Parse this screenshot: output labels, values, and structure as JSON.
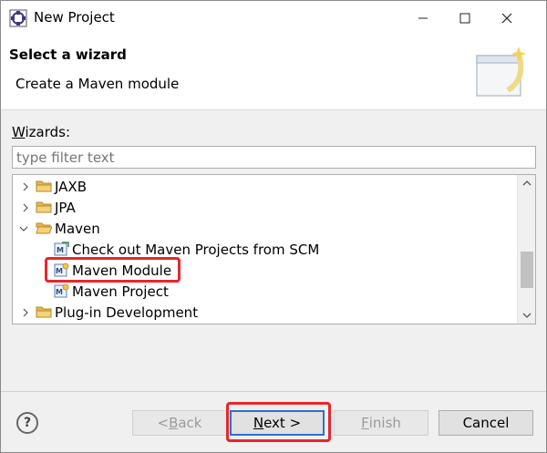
{
  "window": {
    "title": "New Project"
  },
  "banner": {
    "title": "Select a wizard",
    "description": "Create a Maven module"
  },
  "wizards": {
    "label_prefix": "W",
    "label_rest": "izards:",
    "filter_placeholder": "type filter text"
  },
  "tree": {
    "items": [
      {
        "label": "JAXB",
        "type": "folder",
        "expanded": false
      },
      {
        "label": "JPA",
        "type": "folder",
        "expanded": false
      },
      {
        "label": "Maven",
        "type": "folder",
        "expanded": true
      },
      {
        "label": "Check out Maven Projects from SCM",
        "type": "maven-checkout"
      },
      {
        "label": "Maven Module",
        "type": "maven-module",
        "selected": true
      },
      {
        "label": "Maven Project",
        "type": "maven-project"
      },
      {
        "label": "Plug-in Development",
        "type": "folder",
        "expanded": false
      }
    ]
  },
  "buttons": {
    "back_prefix": "< ",
    "back_mnemonic": "B",
    "back_rest": "ack",
    "next_mnemonic": "N",
    "next_rest": "ext >",
    "finish_mnemonic": "F",
    "finish_rest": "inish",
    "cancel": "Cancel",
    "help": "?"
  },
  "colors": {
    "highlight": "#e8262b",
    "folder": "#e6b84d",
    "default_button_border": "#2f6ed4"
  }
}
